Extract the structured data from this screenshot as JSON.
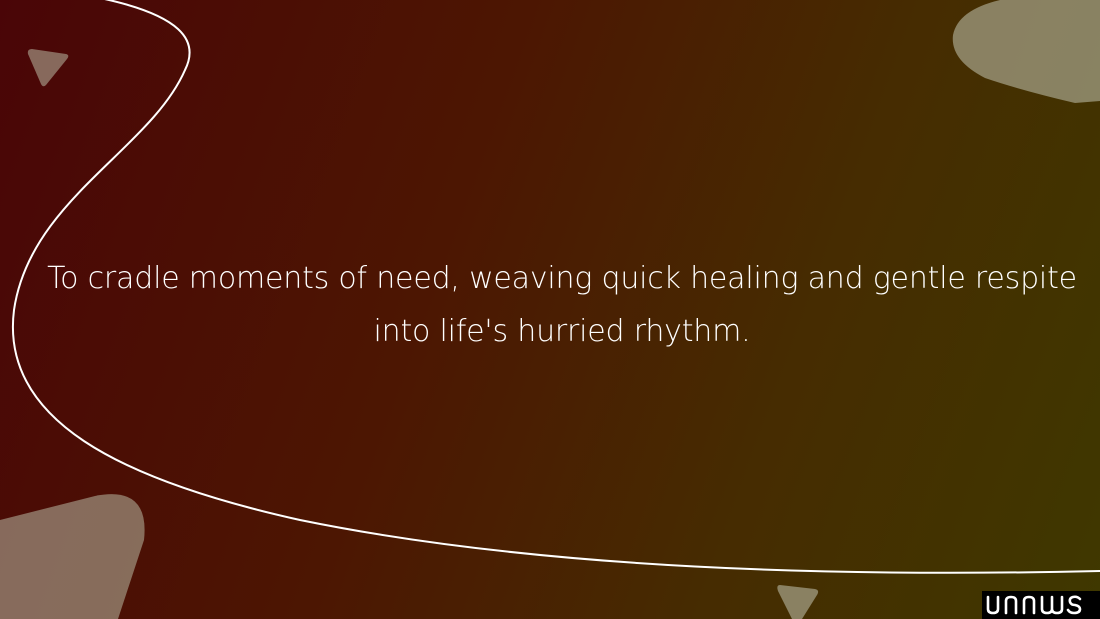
{
  "slide": {
    "quote": "To cradle moments of need, weaving quick healing and gentle respite into life's hurried rhythm.",
    "logo_text": "unnus"
  },
  "colors": {
    "gradient_start": "#4a0507",
    "gradient_mid": "#4c1602",
    "gradient_end": "#3f3800",
    "shape_fill": "#b9b9a4",
    "curve_stroke": "#ffffff",
    "text": "#ffffff",
    "logo_background": "#000000"
  }
}
